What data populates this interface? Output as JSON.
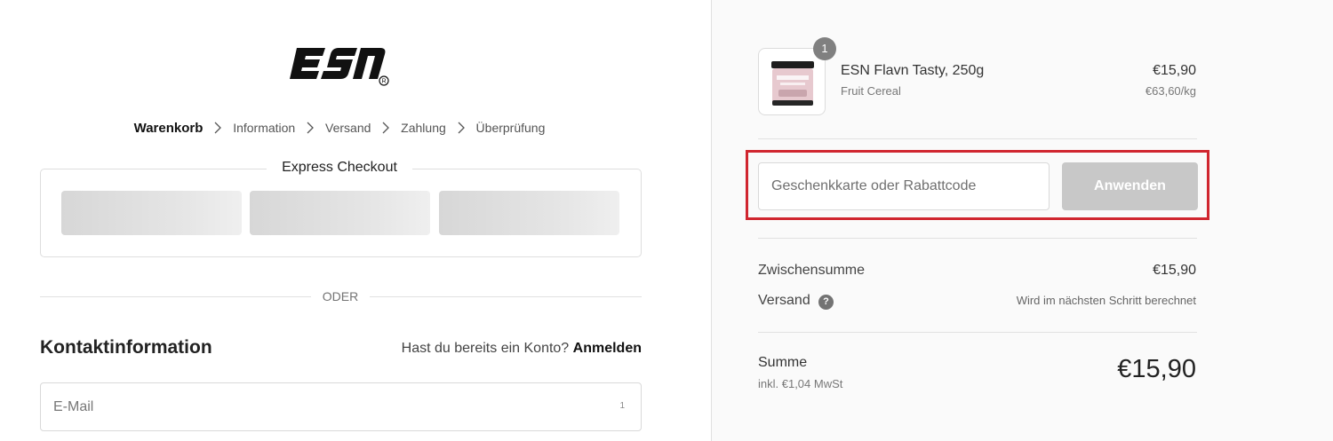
{
  "brand": {
    "logo_text": "ESN",
    "logo_icon": "esn-logo"
  },
  "breadcrumb": {
    "steps": [
      "Warenkorb",
      "Information",
      "Versand",
      "Zahlung",
      "Überprüfung"
    ],
    "separator_icon": "chevron-right-icon"
  },
  "express_checkout": {
    "title": "Express Checkout",
    "button_count": 3
  },
  "divider": {
    "label": "ODER"
  },
  "contact": {
    "title": "Kontaktinformation",
    "login_prompt": "Hast du bereits ein Konto?",
    "login_link": "Anmelden",
    "email_placeholder": "E-Mail",
    "email_marker": "1"
  },
  "order_summary": {
    "product": {
      "quantity": "1",
      "name": "ESN Flavn Tasty, 250g",
      "variant": "Fruit Cereal",
      "price": "€15,90",
      "unit_price": "€63,60/kg"
    },
    "discount": {
      "placeholder": "Geschenkkarte oder Rabattcode",
      "apply_label": "Anwenden"
    },
    "subtotal": {
      "label": "Zwischensumme",
      "value": "€15,90"
    },
    "shipping": {
      "label": "Versand",
      "help_icon": "question-mark-icon",
      "note": "Wird im nächsten Schritt berechnet"
    },
    "total": {
      "label": "Summe",
      "tax_note": "inkl. €1,04 MwSt",
      "value": "€15,90"
    }
  },
  "colors": {
    "highlight": "#d0262f",
    "button_disabled": "#c8c8c8",
    "summary_background": "#fafafa"
  }
}
